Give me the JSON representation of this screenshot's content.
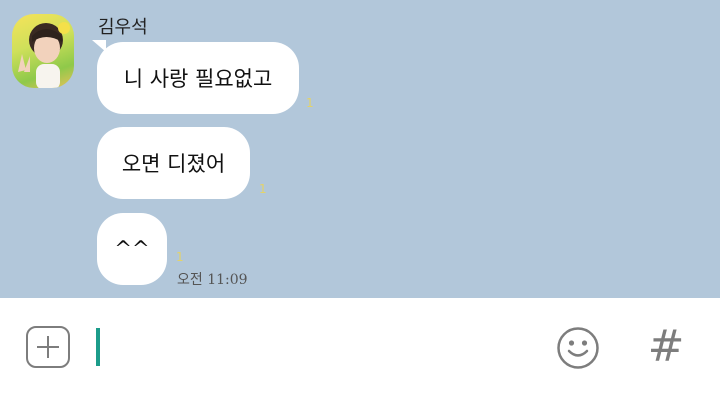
{
  "chat": {
    "sender_name": "김우석",
    "messages": [
      {
        "text": "니 사랑 필요없고",
        "read_count": "1"
      },
      {
        "text": "오면 디졌어",
        "read_count": "1"
      },
      {
        "text": "^^",
        "read_count": "1",
        "time": "오전 11:09"
      }
    ]
  },
  "input_bar": {
    "placeholder": "",
    "plus_icon": "plus-square-icon",
    "emoji_icon": "smiley-face-icon",
    "hash_label": "#"
  },
  "colors": {
    "chat_background": "#b2c7da",
    "bubble": "#ffffff",
    "read_count": "#e3d36a",
    "cursor": "#1c9c8a",
    "icon_gray": "#7d7d7d"
  }
}
